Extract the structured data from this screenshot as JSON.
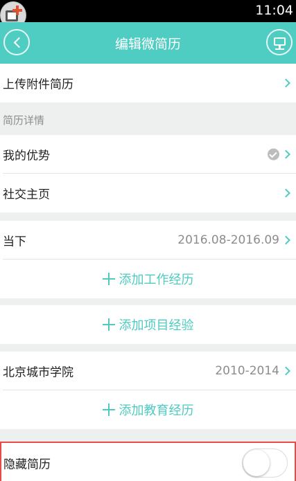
{
  "status_bar": {
    "time": "11:04"
  },
  "navbar": {
    "title": "编辑微简历"
  },
  "rows": {
    "upload": "上传附件简历",
    "details_header": "简历详情",
    "advantages": "我的优势",
    "social": "社交主页",
    "work_label": "当下",
    "work_value": "2016.08-2016.09",
    "add_work": "添加工作经历",
    "add_project": "添加项目经验",
    "school_label": "北京城市学院",
    "school_value": "2010-2014",
    "add_education": "添加教育经历",
    "hide_resume": "隐藏简历"
  },
  "toggle": {
    "hide_resume_on": false
  },
  "colors": {
    "accent": "#50cdc3",
    "highlight_border": "#e84a4a"
  }
}
